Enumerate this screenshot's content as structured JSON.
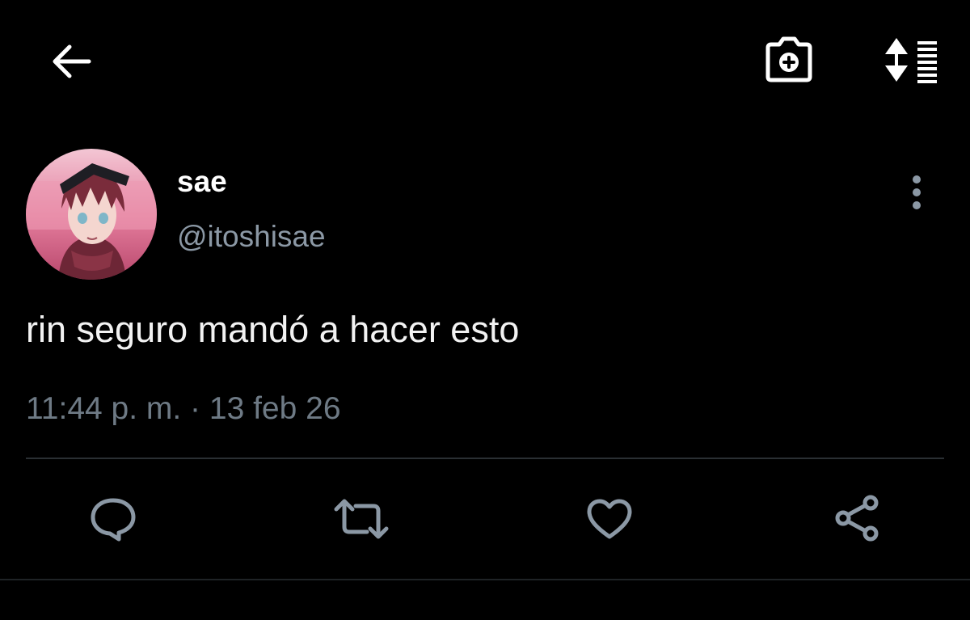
{
  "header": {
    "back_icon": "arrow-left-icon",
    "camera_icon": "camera-plus-icon",
    "sort_icon": "sort-list-icon"
  },
  "tweet": {
    "author": {
      "display_name": "sae",
      "handle": "@itoshisae",
      "avatar": "anime-character-avatar"
    },
    "text": "rin seguro mandó a hacer esto",
    "timestamp": "11:44 p. m. · 13 feb 26"
  },
  "actions": {
    "reply_icon": "speech-bubble-icon",
    "retweet_icon": "retweet-icon",
    "like_icon": "heart-icon",
    "share_icon": "share-icon"
  },
  "colors": {
    "background": "#000000",
    "primary_text": "#ffffff",
    "secondary_text": "#8b98a5",
    "icon_gray": "#8b98a5",
    "divider": "#2a2f33"
  }
}
